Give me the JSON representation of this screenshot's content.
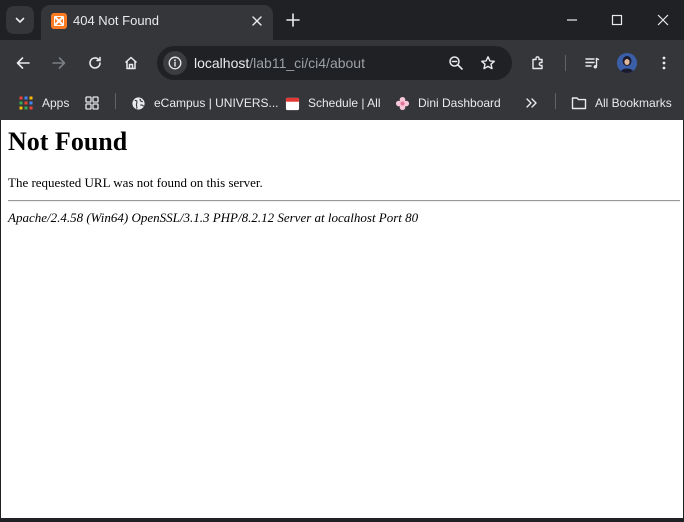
{
  "tab": {
    "title": "404 Not Found",
    "favicon": "xampp-icon"
  },
  "toolbar": {
    "url_host": "localhost",
    "url_path": "/lab11_ci/ci4/about"
  },
  "bookmarks": {
    "items": [
      {
        "label": "Apps",
        "icon": "apps-grid-icon"
      },
      {
        "label": "",
        "icon": "tab-groups-icon"
      },
      {
        "label": "eCampus | UNIVERS...",
        "icon": "globe-icon"
      },
      {
        "label": "Schedule | All",
        "icon": "calendar-icon"
      },
      {
        "label": "Dini Dashboard",
        "icon": "flower-icon"
      }
    ],
    "all_bookmarks": "All Bookmarks"
  },
  "page": {
    "heading": "Not Found",
    "message": "The requested URL was not found on this server.",
    "server_signature": "Apache/2.4.58 (Win64) OpenSSL/3.1.3 PHP/8.2.12 Server at localhost Port 80"
  },
  "colors": {
    "frame": "#202124",
    "toolbar": "#35363a",
    "omnibox": "#202124",
    "favicon_accent": "#fb7a24",
    "page_bg": "#ffffff"
  }
}
